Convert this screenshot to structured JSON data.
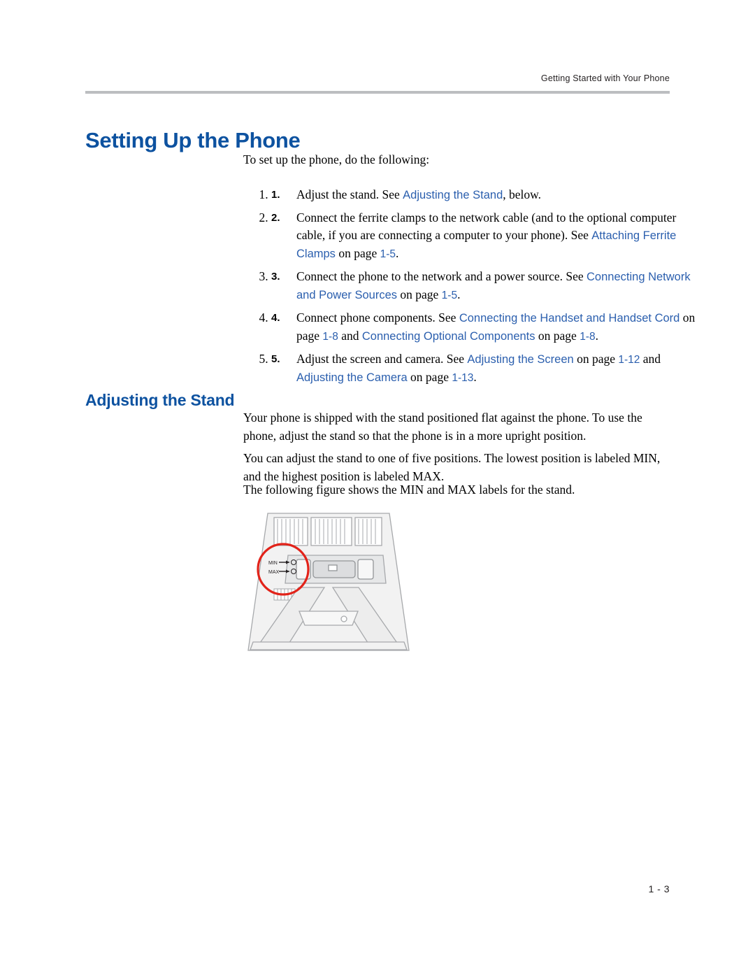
{
  "header": {
    "running_head": "Getting Started with Your Phone"
  },
  "headings": {
    "h1": "Setting Up the Phone",
    "h2": "Adjusting the Stand"
  },
  "intro": "To set up the phone, do the following:",
  "steps": [
    {
      "num": "1.",
      "parts": [
        {
          "t": "Adjust the stand. See ",
          "s": "plain"
        },
        {
          "t": "Adjusting the Stand",
          "s": "xref-sans"
        },
        {
          "t": ", below.",
          "s": "plain"
        }
      ]
    },
    {
      "num": "2.",
      "parts": [
        {
          "t": "Connect the ferrite clamps to the network cable (and to the optional computer cable, if you are connecting a computer to your phone). See ",
          "s": "plain"
        },
        {
          "t": "Attaching Ferrite Clamps",
          "s": "xref-sans"
        },
        {
          "t": " on page ",
          "s": "plain"
        },
        {
          "t": "1-5",
          "s": "pg"
        },
        {
          "t": ".",
          "s": "plain"
        }
      ]
    },
    {
      "num": "3.",
      "parts": [
        {
          "t": "Connect the phone to the network and a power source. See ",
          "s": "plain"
        },
        {
          "t": "Connecting Network and Power Sources",
          "s": "xref-sans"
        },
        {
          "t": " on page ",
          "s": "plain"
        },
        {
          "t": "1-5",
          "s": "pg"
        },
        {
          "t": ".",
          "s": "plain"
        }
      ]
    },
    {
      "num": "4.",
      "parts": [
        {
          "t": "Connect phone components. See ",
          "s": "plain"
        },
        {
          "t": "Connecting the Handset and Handset Cord",
          "s": "xref-sans"
        },
        {
          "t": " on page ",
          "s": "plain"
        },
        {
          "t": "1-8",
          "s": "pg"
        },
        {
          "t": " and ",
          "s": "plain"
        },
        {
          "t": "Connecting Optional Components",
          "s": "xref-sans"
        },
        {
          "t": " on page ",
          "s": "plain"
        },
        {
          "t": "1-8",
          "s": "pg"
        },
        {
          "t": ".",
          "s": "plain"
        }
      ]
    },
    {
      "num": "5.",
      "parts": [
        {
          "t": "Adjust the screen and camera. See ",
          "s": "plain"
        },
        {
          "t": "Adjusting the Screen",
          "s": "xref-sans"
        },
        {
          "t": " on page ",
          "s": "plain"
        },
        {
          "t": "1-12",
          "s": "pg"
        },
        {
          "t": " and ",
          "s": "plain"
        },
        {
          "t": "Adjusting the Camera",
          "s": "xref-sans"
        },
        {
          "t": " on page ",
          "s": "plain"
        },
        {
          "t": "1-13",
          "s": "pg"
        },
        {
          "t": ".",
          "s": "plain"
        }
      ]
    }
  ],
  "paragraphs": {
    "p1": "Your phone is shipped with the stand positioned flat against the phone. To use the phone, adjust the stand so that the phone is in a more upright position.",
    "p2": "You can adjust the stand to one of five positions. The lowest position is labeled MIN, and the highest position is labeled MAX.",
    "p3": "The following figure shows the MIN and MAX labels for the stand."
  },
  "figure": {
    "label_min": "MIN",
    "label_max": "MAX",
    "highlight_color": "#e2231a"
  },
  "footer": {
    "page_number": "1 - 3"
  }
}
